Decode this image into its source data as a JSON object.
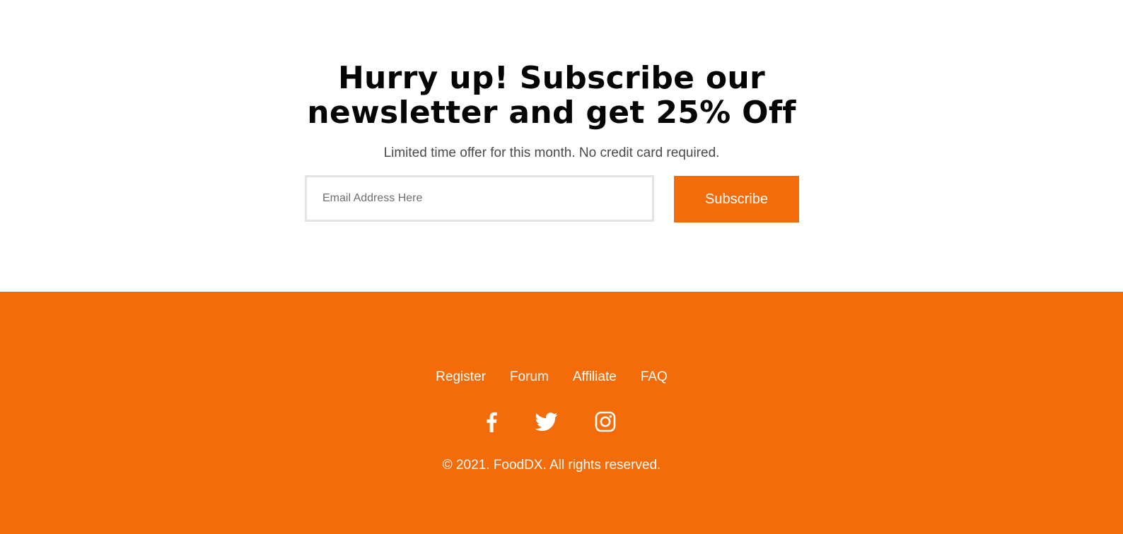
{
  "newsletter": {
    "headline_line1": "Hurry up! Subscribe our",
    "headline_line2": "newsletter and get 25% Off",
    "subtitle": "Limited time offer for this month. No credit card required.",
    "email_value": "",
    "email_placeholder": "Email Address Here",
    "subscribe_label": "Subscribe"
  },
  "footer": {
    "links": [
      "Register",
      "Forum",
      "Affiliate",
      "FAQ"
    ],
    "social_icons": [
      "facebook-icon",
      "twitter-icon",
      "instagram-icon"
    ],
    "copyright": "© 2021. FoodDX. All rights reserved."
  },
  "colors": {
    "accent": "#f36c09",
    "heading": "#050505",
    "subtitle": "#4a4a4a",
    "input_border": "#e4e4e4",
    "footer_text": "#ffffff"
  }
}
